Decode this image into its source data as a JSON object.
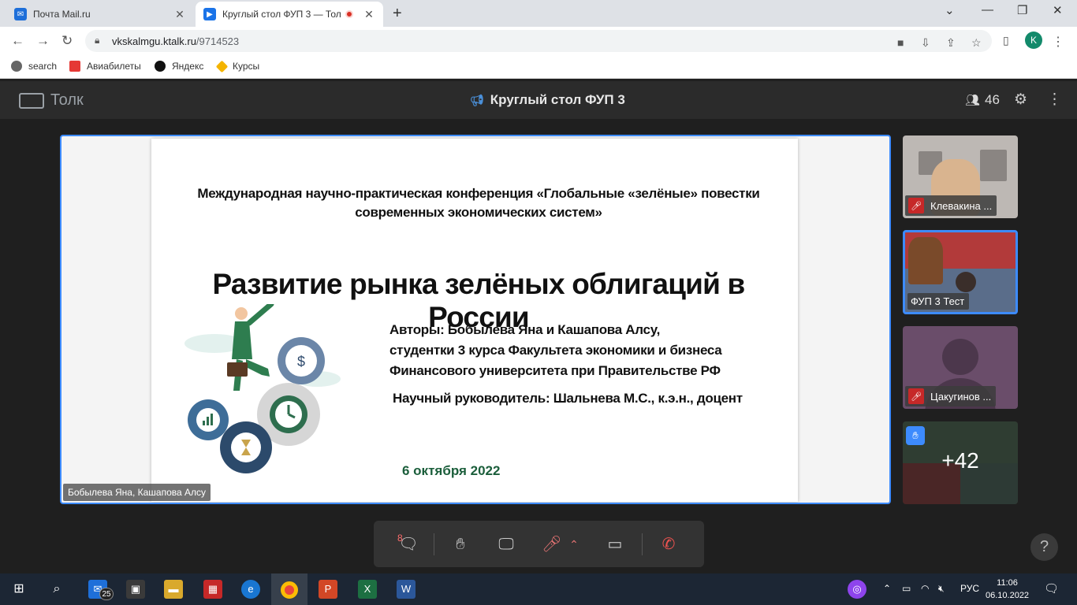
{
  "browser": {
    "tabs": [
      {
        "title": "Почта Mail.ru",
        "active": false
      },
      {
        "title": "Круглый стол ФУП 3 — Тол",
        "active": true
      }
    ],
    "url_host": "vkskalmgu.ktalk.ru",
    "url_path": "/9714523",
    "profile_initial": "K",
    "bookmarks": [
      {
        "label": "search"
      },
      {
        "label": "Авиабилеты"
      },
      {
        "label": "Яндекс"
      },
      {
        "label": "Курсы"
      }
    ]
  },
  "app": {
    "logo_text": "Толк",
    "room_title": "Круглый стол ФУП 3",
    "participant_count": "46"
  },
  "slide": {
    "conference": "Международная научно-практическая конференция «Глобальные «зелёные» повестки современных экономических систем»",
    "title": "Развитие рынка зелёных облигаций в России",
    "authors_line1": "Авторы: Бобылева Яна и Кашапова Алсу,",
    "authors_line2": "студентки 3 курса Факультета экономики и бизнеса",
    "authors_line3": "Финансового университета при Правительстве РФ",
    "supervisor": "Научный руководитель: Шальнева М.С., к.э.н., доцент",
    "date": "6 октября 2022"
  },
  "stage": {
    "speaker_caption": "Бобылева Яна, Кашапова Алсу"
  },
  "tiles": [
    {
      "name": "Клевакина ...",
      "muted": true
    },
    {
      "name": "ФУП 3 Тест",
      "muted": false
    },
    {
      "name": "Цакугинов ...",
      "muted": true
    },
    {
      "overflow": "+42"
    }
  ],
  "controls": {
    "chat_badge": "8"
  },
  "taskbar": {
    "mail_badge": "25",
    "language": "РУС",
    "time": "11:06",
    "date": "06.10.2022"
  },
  "colors": {
    "accent": "#3d8bfd",
    "header_bg": "#2b2b2b",
    "stage_bg": "#1f1f1f",
    "muted_red": "#c62828"
  }
}
